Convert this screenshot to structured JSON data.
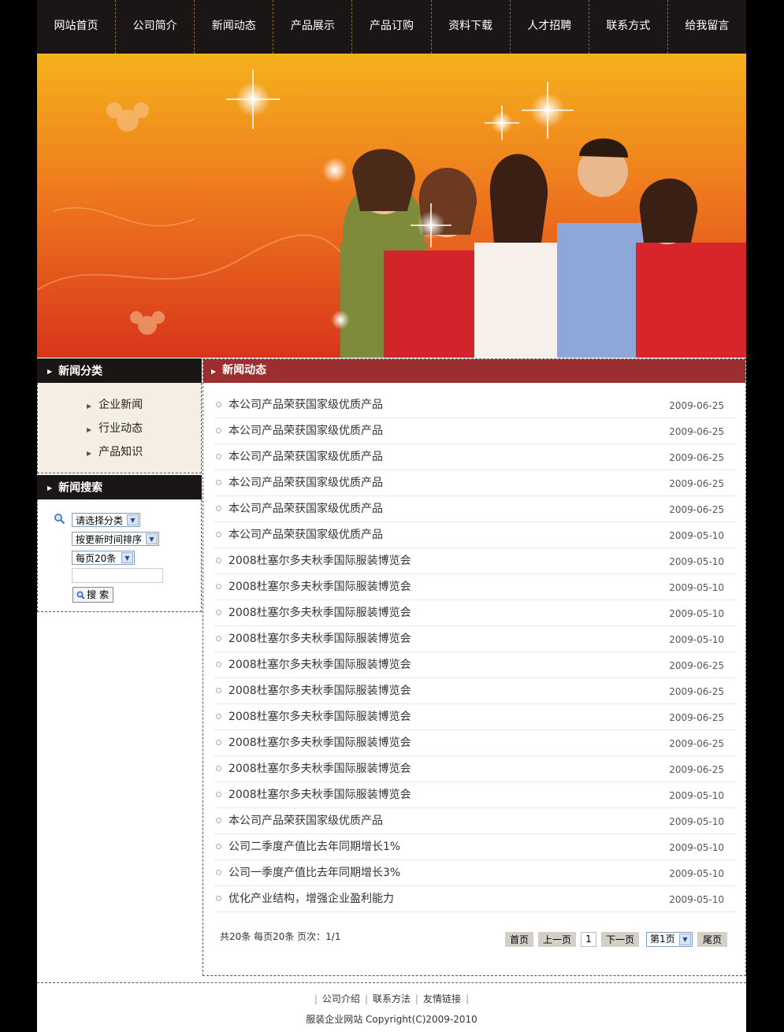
{
  "nav": [
    "网站首页",
    "公司简介",
    "新闻动态",
    "产品展示",
    "产品订购",
    "资料下载",
    "人才招聘",
    "联系方式",
    "给我留言"
  ],
  "sidebar": {
    "category_title": "新闻分类",
    "categories": [
      "企业新闻",
      "行业动态",
      "产品知识"
    ],
    "search_title": "新闻搜索",
    "select_category": "请选择分类",
    "select_sort": "按更新时间排序",
    "select_per_page": "每页20条",
    "search_button": "搜 索"
  },
  "main": {
    "title": "新闻动态",
    "news": [
      {
        "title": "本公司产品荣获国家级优质产品",
        "date": "2009-06-25"
      },
      {
        "title": "本公司产品荣获国家级优质产品",
        "date": "2009-06-25"
      },
      {
        "title": "本公司产品荣获国家级优质产品",
        "date": "2009-06-25"
      },
      {
        "title": "本公司产品荣获国家级优质产品",
        "date": "2009-06-25"
      },
      {
        "title": "本公司产品荣获国家级优质产品",
        "date": "2009-06-25"
      },
      {
        "title": "本公司产品荣获国家级优质产品",
        "date": "2009-05-10"
      },
      {
        "title": "2008杜塞尔多夫秋季国际服装博览会",
        "date": "2009-05-10"
      },
      {
        "title": "2008杜塞尔多夫秋季国际服装博览会",
        "date": "2009-05-10"
      },
      {
        "title": "2008杜塞尔多夫秋季国际服装博览会",
        "date": "2009-05-10"
      },
      {
        "title": "2008杜塞尔多夫秋季国际服装博览会",
        "date": "2009-05-10"
      },
      {
        "title": "2008杜塞尔多夫秋季国际服装博览会",
        "date": "2009-06-25"
      },
      {
        "title": "2008杜塞尔多夫秋季国际服装博览会",
        "date": "2009-06-25"
      },
      {
        "title": "2008杜塞尔多夫秋季国际服装博览会",
        "date": "2009-06-25"
      },
      {
        "title": "2008杜塞尔多夫秋季国际服装博览会",
        "date": "2009-06-25"
      },
      {
        "title": "2008杜塞尔多夫秋季国际服装博览会",
        "date": "2009-06-25"
      },
      {
        "title": "2008杜塞尔多夫秋季国际服装博览会",
        "date": "2009-05-10"
      },
      {
        "title": "本公司产品荣获国家级优质产品",
        "date": "2009-05-10"
      },
      {
        "title": "公司二季度产值比去年同期增长1%",
        "date": "2009-05-10"
      },
      {
        "title": "公司一季度产值比去年同期增长3%",
        "date": "2009-05-10"
      },
      {
        "title": "优化产业结构，增强企业盈利能力",
        "date": "2009-05-10"
      }
    ],
    "pagination": {
      "info": "共20条  每页20条  页次：1/1",
      "first": "首页",
      "prev": "上一页",
      "current": "1",
      "next": "下一页",
      "page_select": "第1页",
      "last": "尾页"
    }
  },
  "footer": {
    "links": [
      "公司介绍",
      "联系方法",
      "友情链接"
    ],
    "copyright": "服装企业网站  Copyright(C)2009-2010"
  },
  "colors": {
    "nav_bg": "#1b1616",
    "main_header": "#9b2e2e",
    "sidebar_bg": "#f5efe3"
  }
}
